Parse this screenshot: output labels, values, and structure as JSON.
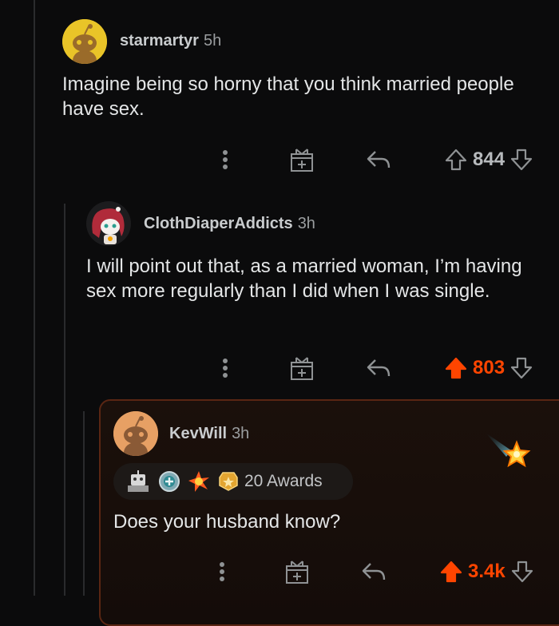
{
  "comments": [
    {
      "username": "starmartyr",
      "age": "5h",
      "body": "Imagine being so horny that you think married people have sex.",
      "votes": "844"
    },
    {
      "username": "ClothDiaperAddicts",
      "age": "3h",
      "body": "I will point out that, as a married woman, I’m having sex more regularly than I did when I was single.",
      "votes": "803"
    },
    {
      "username": "KevWill",
      "age": "3h",
      "awards": "20 Awards",
      "body": "Does your husband know?",
      "votes": "3.4k"
    }
  ],
  "colors": {
    "upvote_accent": "#ff4500",
    "highlight_border": "#5a2613",
    "background": "#0b0b0c"
  },
  "icons": [
    "more-icon",
    "gift-icon",
    "reply-icon",
    "upvote-icon",
    "downvote-icon",
    "shooting-star-icon"
  ]
}
